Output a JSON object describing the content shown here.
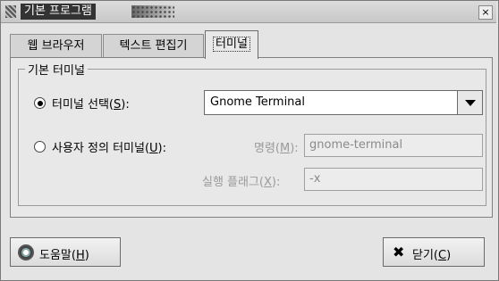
{
  "window": {
    "title": "기본 프로그램",
    "close_glyph": "×"
  },
  "tabs": [
    {
      "label": "웹 브라우저"
    },
    {
      "label": "텍스트 편집기"
    },
    {
      "label": "터미널"
    }
  ],
  "group": {
    "label": "기본 터미널",
    "select_radio": {
      "text": "터미널 선택(",
      "mnemonic": "S",
      "suffix": "):",
      "checked": true
    },
    "select_value": "Gnome Terminal",
    "custom_radio": {
      "text": "사용자 정의 터미널(",
      "mnemonic": "U",
      "suffix": "):",
      "checked": false
    },
    "command": {
      "text": "명령(",
      "mnemonic": "M",
      "suffix": "):",
      "value": "gnome-terminal"
    },
    "exec_flag": {
      "text": "실행 플래그(",
      "mnemonic": "X",
      "suffix": "):",
      "value": "-x"
    }
  },
  "buttons": {
    "help": {
      "text": "도움말(",
      "mnemonic": "H",
      "suffix": ")"
    },
    "close": {
      "text": "닫기(",
      "mnemonic": "C",
      "suffix": ")",
      "icon": "✖"
    }
  }
}
